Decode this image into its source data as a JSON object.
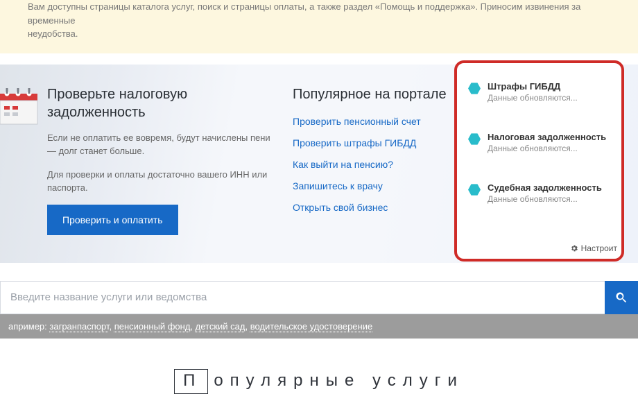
{
  "notice": {
    "line1": "Вам доступны страницы каталога услуг, поиск и страницы оплаты, а также раздел «Помощь и поддержка». Приносим извинения за временные",
    "line2": "неудобства."
  },
  "tax": {
    "heading": "Проверьте налоговую задолженность",
    "p1": "Если не оплатить ее вовремя, будут начислены пени — долг станет больше.",
    "p2": "Для проверки и оплаты достаточно вашего ИНН или паспорта.",
    "button": "Проверить и оплатить"
  },
  "popular": {
    "heading": "Популярное на портале",
    "links": {
      "0": "Проверить пенсионный счет",
      "1": "Проверить штрафы ГИБДД",
      "2": "Как выйти на пенсию?",
      "3": "Запишитесь к врачу",
      "4": "Открыть свой бизнес"
    }
  },
  "panel": {
    "items": {
      "0": {
        "title": "Штрафы ГИБДД",
        "sub": "Данные обновляются..."
      },
      "1": {
        "title": "Налоговая задолженность",
        "sub": "Данные обновляются..."
      },
      "2": {
        "title": "Судебная задолженность",
        "sub": "Данные обновляются..."
      }
    },
    "settings": "Настроит"
  },
  "search": {
    "placeholder": "Введите название услуги или ведомства"
  },
  "examples": {
    "prefix": "апример: ",
    "e0": "загранпаспорт",
    "e1": "пенсионный фонд",
    "e2": "детский сад",
    "e3": "водительское удостоверение"
  },
  "popular_services_title": "опулярные услуги"
}
